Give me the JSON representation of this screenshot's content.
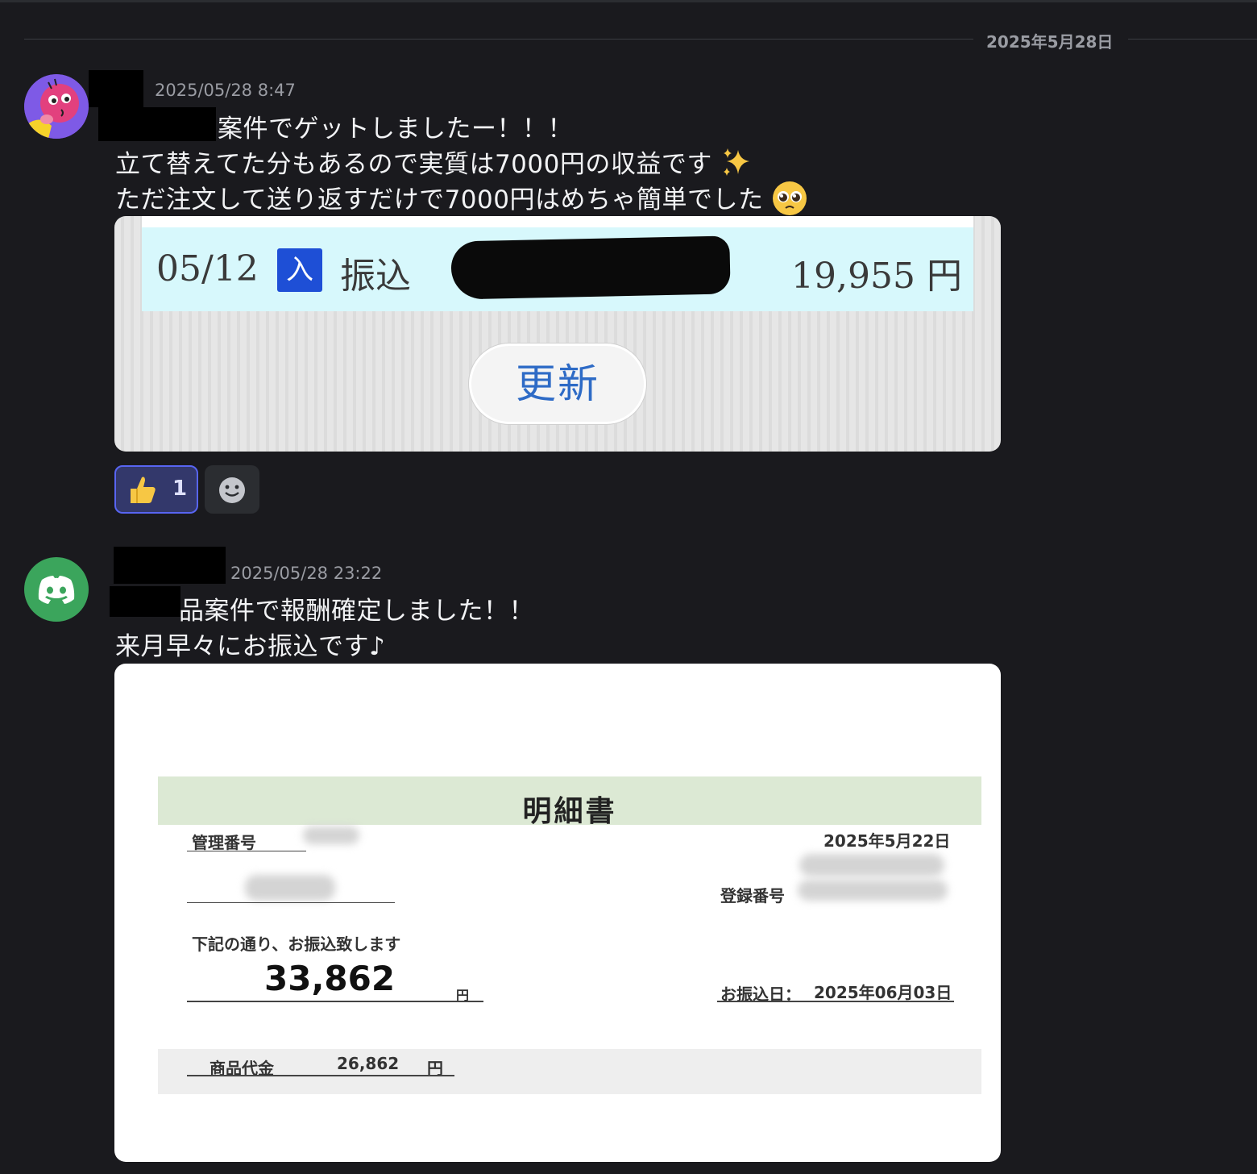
{
  "date_divider": "2025年5月28日",
  "messages": [
    {
      "timestamp": "2025/05/28 8:47",
      "lines": [
        "案件でゲットしましたー！！！",
        "立て替えてた分もあるので実質は7000円の収益です",
        "ただ注文して送り返すだけで7000円はめちゃ簡単でした"
      ],
      "emojis": [
        "sparkles-emoji",
        "pleading-face-emoji"
      ],
      "attachment": {
        "date": "05/12",
        "badge": "入",
        "kind": "振込",
        "amount": "19,955 円",
        "refresh_button": "更新"
      },
      "reactions": [
        {
          "emoji": "thumbs-up",
          "count": "1"
        }
      ]
    },
    {
      "timestamp": "2025/05/28 23:22",
      "lines": [
        "品案件で報酬確定しました！！",
        "来月早々にお振込です♪"
      ],
      "attachment": {
        "title": "明細書",
        "mgmt_label": "管理番号",
        "issue_date": "2025年5月22日",
        "reg_label": "登録番号",
        "notice": "下記の通り、お振込致します",
        "total": "33,862",
        "total_unit": "円",
        "transfer_label": "お振込日：",
        "transfer_date": "2025年06月03日",
        "item_label": "商品代金",
        "item_amount": "26,862",
        "item_unit": "円"
      }
    }
  ],
  "colors": {
    "background": "#1a1a1e",
    "discord_avatar": "#3ba55c",
    "reaction_active_border": "#5865f2"
  }
}
